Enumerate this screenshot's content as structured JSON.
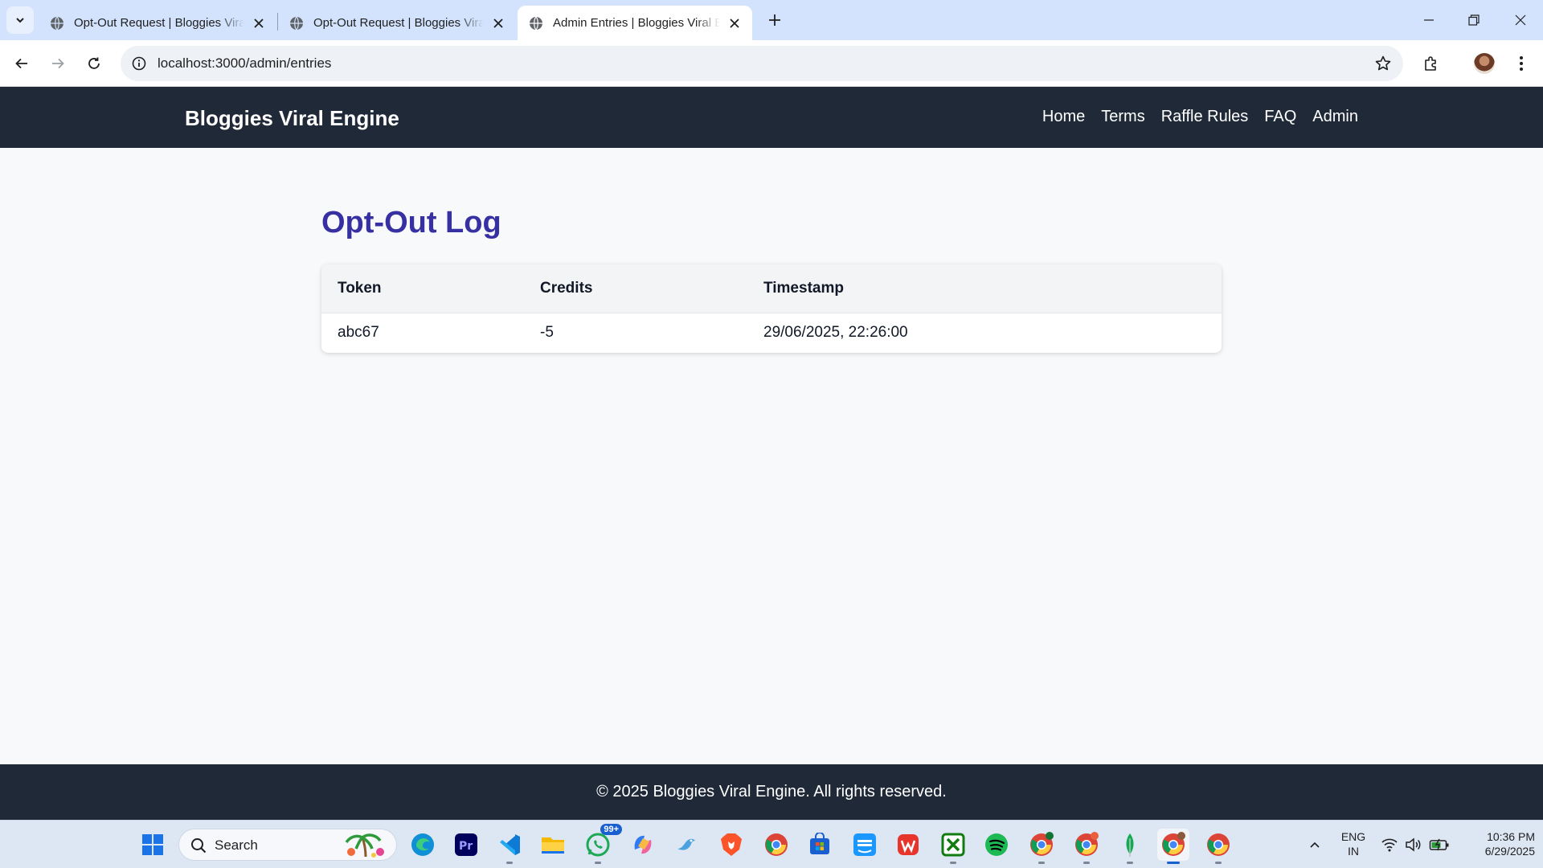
{
  "browser": {
    "tabs": [
      {
        "title": "Opt-Out Request | Bloggies Viral Engine",
        "active": false
      },
      {
        "title": "Opt-Out Request | Bloggies Viral Engine",
        "active": false
      },
      {
        "title": "Admin Entries | Bloggies Viral Engine",
        "active": true
      }
    ],
    "url": "localhost:3000/admin/entries"
  },
  "site": {
    "brand": "Bloggies Viral Engine",
    "nav": [
      "Home",
      "Terms",
      "Raffle Rules",
      "FAQ",
      "Admin"
    ]
  },
  "page": {
    "title": "Opt-Out Log",
    "table": {
      "headers": [
        "Token",
        "Credits",
        "Timestamp"
      ],
      "rows": [
        [
          "abc67",
          "-5",
          "29/06/2025, 22:26:00"
        ]
      ]
    }
  },
  "footer": {
    "text": "© 2025 Bloggies Viral Engine. All rights reserved."
  },
  "taskbar": {
    "search_label": "Search",
    "whatsapp_badge": "99+",
    "lang_top": "ENG",
    "lang_bottom": "IN",
    "time": "10:36 PM",
    "date": "6/29/2025"
  },
  "colors": {
    "title": "#3730a3",
    "nav_bg": "#1f2937",
    "tabstrip": "#d3e3fd"
  }
}
